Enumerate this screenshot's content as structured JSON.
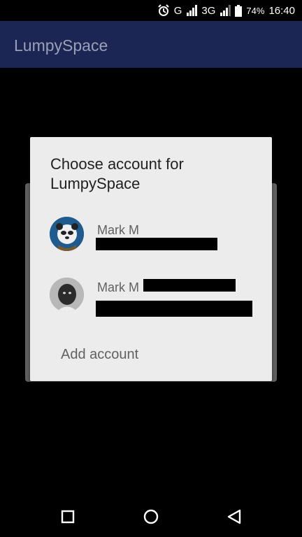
{
  "status_bar": {
    "network_g": "G",
    "network_3g": "3G",
    "battery_percent": "74%",
    "time": "16:40",
    "icons": [
      "alarm-icon",
      "signal-icon",
      "signal-icon",
      "battery-icon"
    ]
  },
  "app_bar": {
    "title": "LumpySpace"
  },
  "dialog": {
    "title": "Choose account for LumpySpace",
    "accounts": [
      {
        "name": "Mark M",
        "avatar": "panda-avatar"
      },
      {
        "name": "Mark M",
        "avatar": "person-avatar"
      }
    ],
    "add_account_label": "Add account"
  },
  "nav_bar": {
    "icons": [
      "recents-icon",
      "home-icon",
      "back-icon"
    ]
  },
  "colors": {
    "app_bar": "#1c2654",
    "dialog_bg": "#ececec",
    "text_secondary": "#616161"
  }
}
